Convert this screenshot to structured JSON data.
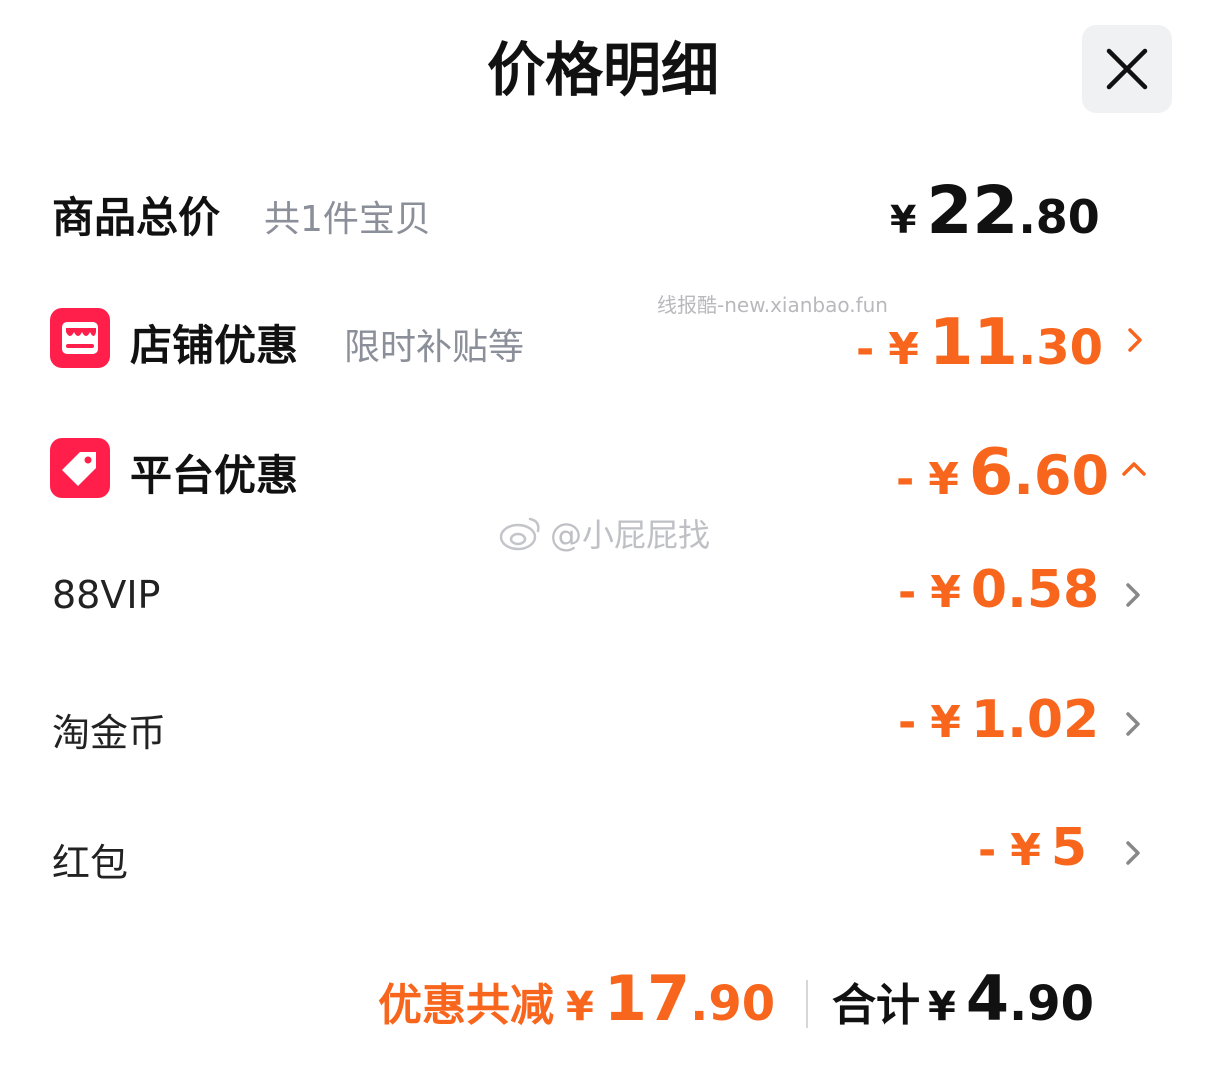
{
  "header": {
    "title": "价格明细",
    "close_icon": "close-icon"
  },
  "watermark": "线报酷-new.xianbao.fun",
  "weibo_watermark": "@小屁屁找",
  "colors": {
    "orange": "#f8661d",
    "red_badge": "#ff1f4a",
    "gray_text": "#8b8f99"
  },
  "total": {
    "label": "商品总价",
    "sub": "共1件宝贝",
    "yen": "¥",
    "int": "22",
    "dec": ".80"
  },
  "shop": {
    "label": "店铺优惠",
    "sub": "限时补贴等",
    "minus": "-",
    "yen": "¥",
    "int": "11",
    "dec": ".30",
    "icon": "shop-icon"
  },
  "platform": {
    "label": "平台优惠",
    "minus": "-",
    "yen": "¥",
    "int": "6",
    "dec": ".60",
    "icon": "tag-icon"
  },
  "items": [
    {
      "label": "88VIP",
      "minus": "-",
      "yen": "¥",
      "amount": "0.58"
    },
    {
      "label": "淘金币",
      "minus": "-",
      "yen": "¥",
      "amount": "1.02"
    },
    {
      "label": "红包",
      "minus": "-",
      "yen": "¥",
      "amount": "5"
    }
  ],
  "footer": {
    "discount_label": "优惠共减",
    "discount_yen": "¥",
    "discount_int": "17",
    "discount_dec": ".90",
    "sum_label": "合计",
    "sum_yen": "¥",
    "sum_int": "4",
    "sum_dec": ".90"
  }
}
